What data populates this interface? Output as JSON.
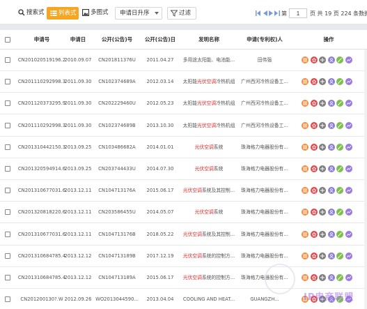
{
  "toolbar": {
    "search_label": "搜索式",
    "list_label": "列表式",
    "grid_label": "多图式",
    "sort_label": "申请日升序",
    "filter_label": "过滤"
  },
  "pager": {
    "prefix": "第",
    "current_page": "1",
    "suffix": "页 共 19 页 224 条数据"
  },
  "columns": [
    "申请号",
    "申请日",
    "公开(公告)号",
    "公开(公告)日",
    "发明名称",
    "申请(专利权)人",
    "操作"
  ],
  "rows": [
    {
      "app_no": "CN201020519196.2",
      "app_date": "2010.09.07",
      "pub_no": "CN201811376U",
      "pub_date": "2011.04.27",
      "title_parts": [
        {
          "t": "多用途太阳能、电池能...",
          "hl": false
        }
      ],
      "applicant": "田伟强"
    },
    {
      "app_no": "CN201110292998.3",
      "app_date": "2011.09.30",
      "pub_no": "CN102374689A",
      "pub_date": "2012.03.14",
      "title_parts": [
        {
          "t": "太阳能",
          "hl": false
        },
        {
          "t": "光伏空调",
          "hl": true
        },
        {
          "t": "冷热机组",
          "hl": false
        }
      ],
      "applicant": "广州西河冷热设备工..."
    },
    {
      "app_no": "CN201120373295.9",
      "app_date": "2011.09.30",
      "pub_no": "CN202229460U",
      "pub_date": "2012.05.23",
      "title_parts": [
        {
          "t": "太阳能",
          "hl": false
        },
        {
          "t": "光伏空调",
          "hl": true
        },
        {
          "t": "冷热机组",
          "hl": false
        }
      ],
      "applicant": "广州西河冷热设备工..."
    },
    {
      "app_no": "CN201110292998.3",
      "app_date": "2011.09.30",
      "pub_no": "CN102374689B",
      "pub_date": "2013.10.30",
      "title_parts": [
        {
          "t": "太阳能",
          "hl": false
        },
        {
          "t": "光伏空调",
          "hl": true
        },
        {
          "t": "冷热机组",
          "hl": false
        }
      ],
      "applicant": "广州西河冷热设备工..."
    },
    {
      "app_no": "CN201310442150.3",
      "app_date": "2013.09.25",
      "pub_no": "CN103486682A",
      "pub_date": "2014.01.01",
      "title_parts": [
        {
          "t": "光伏空调",
          "hl": true
        },
        {
          "t": "系统",
          "hl": false
        }
      ],
      "applicant": "珠海格力电器股份有..."
    },
    {
      "app_no": "CN201320594914.6",
      "app_date": "2013.09.25",
      "pub_no": "CN203744433U",
      "pub_date": "2014.07.30",
      "title_parts": [
        {
          "t": "光伏空调",
          "hl": true
        },
        {
          "t": "系统",
          "hl": false
        }
      ],
      "applicant": "珠海格力电器股份有..."
    },
    {
      "app_no": "CN201310677031.6",
      "app_date": "2013.12.11",
      "pub_no": "CN104713176A",
      "pub_date": "2015.06.17",
      "title_parts": [
        {
          "t": "光伏空调",
          "hl": true
        },
        {
          "t": "系统及其控制...",
          "hl": false
        }
      ],
      "applicant": "珠海格力电器股份有..."
    },
    {
      "app_no": "CN201320818220.6",
      "app_date": "2013.12.11",
      "pub_no": "CN203586455U",
      "pub_date": "2014.05.07",
      "title_parts": [
        {
          "t": "光伏空调",
          "hl": true
        },
        {
          "t": "系统",
          "hl": false
        }
      ],
      "applicant": "珠海格力电器股份有..."
    },
    {
      "app_no": "CN201310677031.6",
      "app_date": "2013.12.11",
      "pub_no": "CN104713176B",
      "pub_date": "2018.05.22",
      "title_parts": [
        {
          "t": "光伏空调",
          "hl": true
        },
        {
          "t": "系统及其控制...",
          "hl": false
        }
      ],
      "applicant": "珠海格力电器股份有..."
    },
    {
      "app_no": "CN201310684785.4",
      "app_date": "2013.12.12",
      "pub_no": "CN104713189B",
      "pub_date": "2017.12.19",
      "title_parts": [
        {
          "t": "光伏空调",
          "hl": true
        },
        {
          "t": "系统的控制方...",
          "hl": false
        }
      ],
      "applicant": "珠海格力电器股份有..."
    },
    {
      "app_no": "CN201310684785.4",
      "app_date": "2013.12.12",
      "pub_no": "CN104713189A",
      "pub_date": "2015.06.17",
      "title_parts": [
        {
          "t": "光伏空调",
          "hl": true
        },
        {
          "t": "系统的控制方...",
          "hl": false
        }
      ],
      "applicant": "珠海格力电器股份有..."
    },
    {
      "app_no": "CN201200130?.W",
      "app_date": "2012.09.26",
      "pub_no": "WO2013044590...",
      "pub_date": "2013.04.04",
      "title_parts": [
        {
          "t": "COOLING AND HEAT...",
          "hl": false
        }
      ],
      "applicant": "GUANGZH..."
    }
  ],
  "action_icons": [
    {
      "name": "list-icon",
      "color": "#f08c3c"
    },
    {
      "name": "star-icon",
      "color": "#e8474a"
    },
    {
      "name": "plus-icon",
      "color": "#7d7d7d"
    },
    {
      "name": "user-icon",
      "color": "#8f7dd6"
    },
    {
      "name": "edit-icon",
      "color": "#7cc04b"
    },
    {
      "name": "trend-icon",
      "color": "#9b7be0"
    }
  ],
  "watermark": "IP电商联盟"
}
